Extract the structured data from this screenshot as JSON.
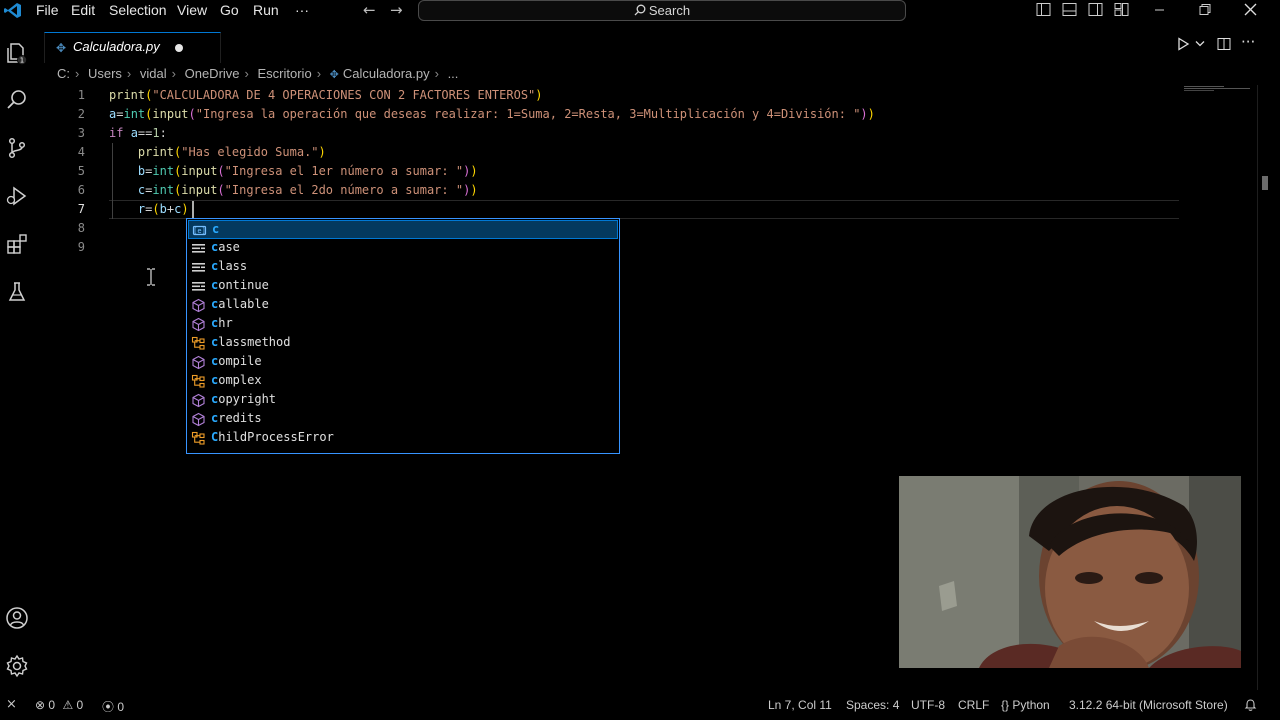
{
  "menu": [
    "File",
    "Edit",
    "Selection",
    "View",
    "Go",
    "Run",
    "···"
  ],
  "search": {
    "label": "Search"
  },
  "tab": {
    "name": "Calculadora.py"
  },
  "breadcrumb": [
    "C:",
    "Users",
    "vidal",
    "OneDrive",
    "Escritorio",
    "Calculadora.py",
    "..."
  ],
  "line_numbers": [
    "1",
    "2",
    "3",
    "4",
    "5",
    "6",
    "7",
    "8",
    "9"
  ],
  "code_lines": [
    "print(\"CALCULADORA DE 4 OPERACIONES CON 2 FACTORES ENTEROS\")",
    "a=int(input(\"Ingresa la operación que deseas realizar: 1=Suma, 2=Resta, 3=Multiplicación y 4=División: \"))",
    "if a==1:",
    "    print(\"Has elegido Suma.\")",
    "    b=int(input(\"Ingresa el 1er número a sumar: \"))",
    "    c=int(input(\"Ingresa el 2do número a sumar: \"))",
    "    r=(b+c)",
    "",
    ""
  ],
  "suggestions": [
    {
      "label": "c",
      "icon": "variable-icon"
    },
    {
      "label": "case",
      "icon": "keyword-icon"
    },
    {
      "label": "class",
      "icon": "keyword-icon"
    },
    {
      "label": "continue",
      "icon": "keyword-icon"
    },
    {
      "label": "callable",
      "icon": "function-icon"
    },
    {
      "label": "chr",
      "icon": "function-icon"
    },
    {
      "label": "classmethod",
      "icon": "class-icon"
    },
    {
      "label": "compile",
      "icon": "function-icon"
    },
    {
      "label": "complex",
      "icon": "class-icon"
    },
    {
      "label": "copyright",
      "icon": "function-icon"
    },
    {
      "label": "credits",
      "icon": "function-icon"
    },
    {
      "label": "ChildProcessError",
      "icon": "class-icon"
    }
  ],
  "status": {
    "errors": "0",
    "warnings": "0",
    "ports": "0",
    "position": "Ln 7, Col 11",
    "spaces": "Spaces: 4",
    "encoding": "UTF-8",
    "eol": "CRLF",
    "language": "Python",
    "interpreter": "3.12.2 64-bit (Microsoft Store)"
  },
  "colors": {
    "accent": "#0078d4",
    "suggest_border": "#3794ff",
    "match_highlight": "#2aaaff",
    "string": "#ce9178",
    "function": "#dcdcaa",
    "keyword": "#c586c0",
    "variable": "#9cdcfe"
  }
}
